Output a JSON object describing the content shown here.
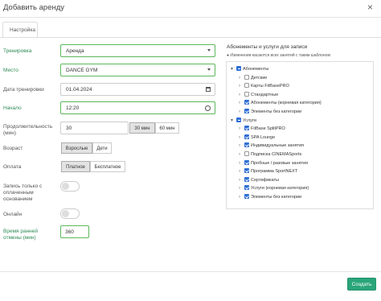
{
  "modal": {
    "title": "Добавить аренду",
    "close_glyph": "×"
  },
  "tabs": [
    "Настройка"
  ],
  "form": {
    "training_label": "Тренировка",
    "training_value": "Аренда",
    "place_label": "Место",
    "place_value": "DANCE GYM",
    "date_label": "Дата тренировки",
    "date_value": "01.04.2024",
    "start_label": "Начало",
    "start_value": "12:20",
    "duration_label": "Продолжительность (мин)",
    "duration_value": "30",
    "duration_options": [
      "30 мин",
      "60 мин"
    ],
    "age_label": "Возраст",
    "age_options": [
      "Взрослые",
      "Дети"
    ],
    "payment_label": "Оплата",
    "payment_options": [
      "Платное",
      "Бесплатное"
    ],
    "paid_only_label": "Запись только с оплаченным основанием",
    "online_label": "Онлайн",
    "cancel_label": "Время ранней отмены (мин)",
    "cancel_value": "360"
  },
  "memberships": {
    "title": "Абонементы и услуги для записи",
    "subtitle": "● Изменения касаются всех занятий с таким шаблоном",
    "tree": [
      {
        "label": "Абонементы",
        "level": 0,
        "chev": "▾",
        "state": "part"
      },
      {
        "label": "Детские",
        "level": 1,
        "chev": "›",
        "state": "off"
      },
      {
        "label": "Карты FitBasePRO",
        "level": 1,
        "chev": "›",
        "state": "off"
      },
      {
        "label": "Стандартные",
        "level": 1,
        "chev": "›",
        "state": "off"
      },
      {
        "label": "Абонементы (корневая категория)",
        "level": 1,
        "chev": "›",
        "state": "on"
      },
      {
        "label": "Элементы без категории",
        "level": 1,
        "chev": "›",
        "state": "on"
      },
      {
        "label": "Услуги",
        "level": 0,
        "chev": "▾",
        "state": "part"
      },
      {
        "label": "FitBase SplitPRO",
        "level": 1,
        "chev": "›",
        "state": "on"
      },
      {
        "label": "SPA Lounge",
        "level": 1,
        "chev": "›",
        "state": "on"
      },
      {
        "label": "Индивидуальные занятия",
        "level": 1,
        "chev": "›",
        "state": "on"
      },
      {
        "label": "Подписка CINEMASports",
        "level": 1,
        "chev": "›",
        "state": "off"
      },
      {
        "label": "Пробные / разовые занятия",
        "level": 1,
        "chev": "›",
        "state": "on"
      },
      {
        "label": "Программа SportNEXT",
        "level": 1,
        "chev": "›",
        "state": "on"
      },
      {
        "label": "Сертификаты",
        "level": 1,
        "chev": "›",
        "state": "on"
      },
      {
        "label": "Услуги (корневая категория)",
        "level": 1,
        "chev": "›",
        "state": "on"
      },
      {
        "label": "Элементы без категории",
        "level": 1,
        "chev": "›",
        "state": "on"
      }
    ]
  },
  "footer": {
    "create_label": "Создать"
  }
}
